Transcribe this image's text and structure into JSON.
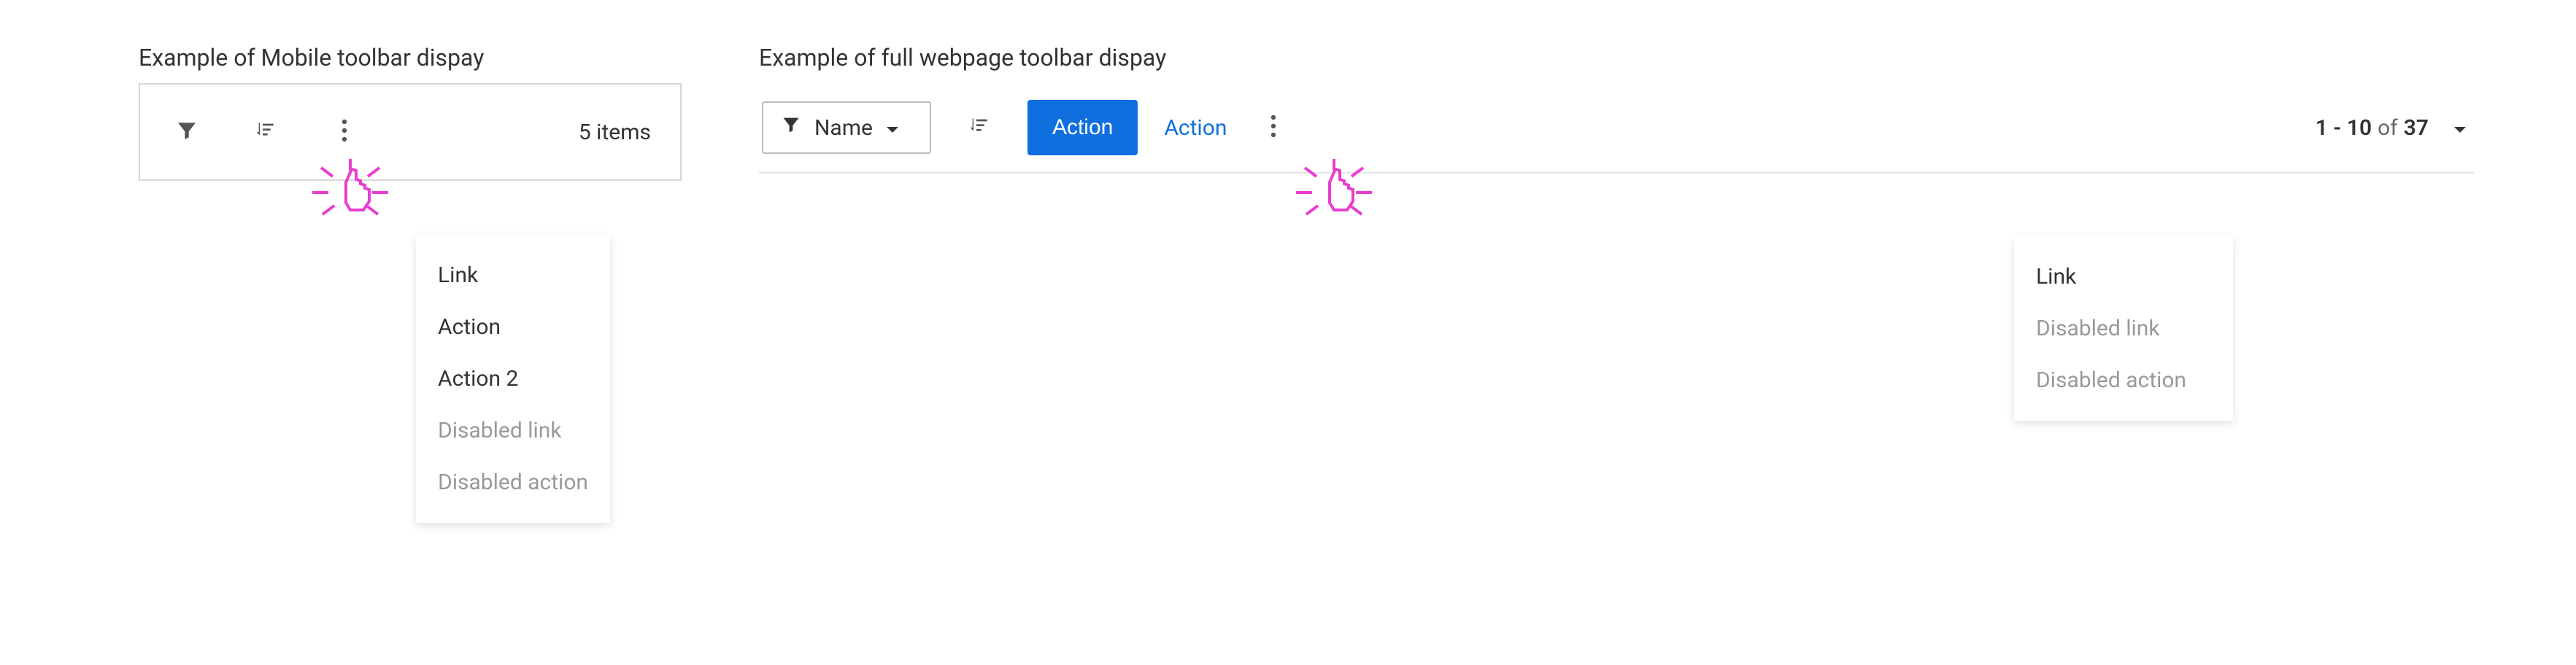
{
  "mobile_example": {
    "title": "Example of Mobile toolbar dispay",
    "item_count_text": "5 items",
    "dropdown": {
      "items": [
        {
          "label": "Link",
          "disabled": false
        },
        {
          "label": "Action",
          "disabled": false
        },
        {
          "label": "Action 2",
          "disabled": false
        },
        {
          "label": "Disabled link",
          "disabled": true
        },
        {
          "label": "Disabled action",
          "disabled": true
        }
      ]
    }
  },
  "full_example": {
    "title": "Example of  full webpage  toolbar dispay",
    "filter_label": "Name",
    "primary_action_label": "Action",
    "secondary_action_label": "Action",
    "dropdown": {
      "items": [
        {
          "label": "Link",
          "disabled": false
        },
        {
          "label": "Disabled link",
          "disabled": true
        },
        {
          "label": "Disabled action",
          "disabled": true
        }
      ]
    },
    "pagination": {
      "range": "1 - 10",
      "of_word": "of",
      "total": "37"
    }
  },
  "icons": {
    "filter": "filter-icon",
    "sort": "sort-icon",
    "kebab": "kebab-icon",
    "chevron_down": "chevron-down-icon",
    "pointer": "pointer-click-icon"
  },
  "colors": {
    "primary": "#0f6fde",
    "text": "#333333",
    "muted": "#999999",
    "border": "#d7d7d7",
    "pointer": "#e83ecf"
  }
}
